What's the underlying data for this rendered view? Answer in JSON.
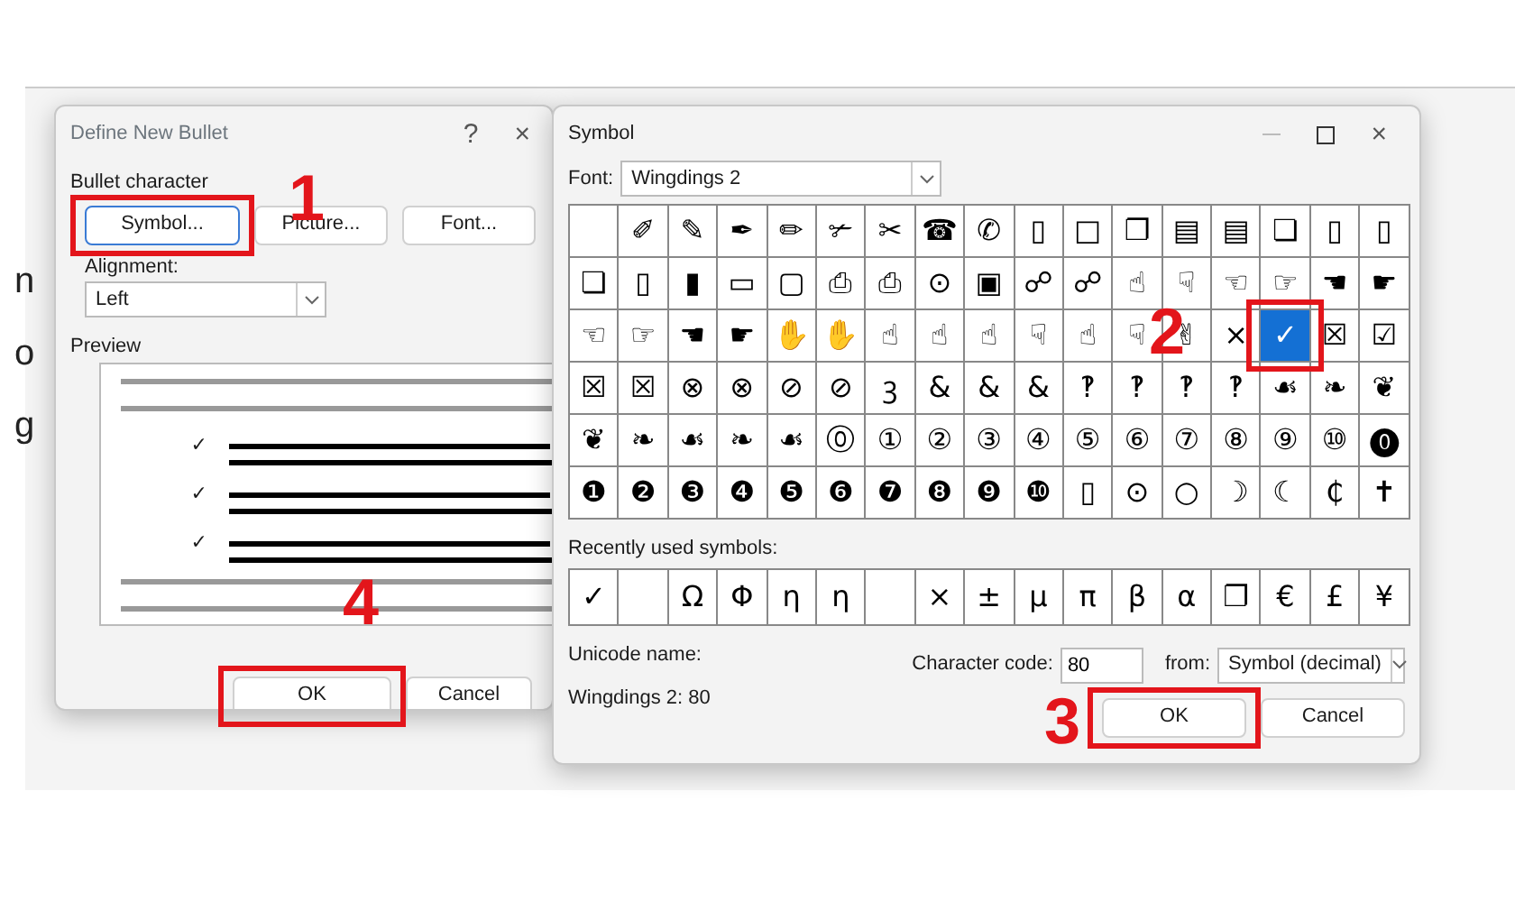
{
  "document": {
    "lines": [
      "n",
      "o",
      "g"
    ]
  },
  "bullet_dialog": {
    "title": "Define New Bullet",
    "help": "?",
    "close": "×",
    "section": "Bullet character",
    "buttons": [
      {
        "label": "Symbol...",
        "focused": true
      },
      {
        "label": "Picture...",
        "focused": false
      },
      {
        "label": "Font...",
        "focused": false
      }
    ],
    "alignment_label": "Alignment:",
    "alignment": "Left",
    "preview_label": "Preview",
    "preview_bullets": [
      "✓",
      "✓",
      "✓"
    ],
    "actions": [
      {
        "label": "OK"
      },
      {
        "label": "Cancel"
      }
    ]
  },
  "symbol_dialog": {
    "title": "Symbol",
    "close": "×",
    "font_label": "Font:",
    "font": "Wingdings 2",
    "grid": [
      [
        {
          "selected": false
        },
        {
          "char": "✐",
          "selected": false
        },
        {
          "char": "✎",
          "selected": false
        },
        {
          "char": "✒",
          "selected": false
        },
        {
          "char": "✏",
          "selected": false
        },
        {
          "char": "✃",
          "selected": false
        },
        {
          "char": "✂",
          "selected": false
        },
        {
          "char": "☎",
          "selected": false
        },
        {
          "char": "✆",
          "selected": false
        },
        {
          "char": "▯",
          "selected": false
        },
        {
          "char": "□",
          "selected": false
        },
        {
          "char": "❐",
          "selected": false
        },
        {
          "char": "▤",
          "selected": false
        },
        {
          "char": "▤",
          "selected": false
        },
        {
          "char": "❏",
          "selected": false
        },
        {
          "char": "▯",
          "selected": false
        },
        {
          "char": "▯",
          "selected": false
        }
      ],
      [
        {
          "char": "❏",
          "selected": false
        },
        {
          "char": "▯",
          "selected": false
        },
        {
          "char": "▮",
          "selected": false
        },
        {
          "char": "▭",
          "selected": false
        },
        {
          "char": "▢",
          "selected": false
        },
        {
          "char": "⎙",
          "selected": false
        },
        {
          "char": "⎙",
          "selected": false
        },
        {
          "char": "⊙",
          "selected": false
        },
        {
          "char": "▣",
          "selected": false
        },
        {
          "char": "☍",
          "selected": false
        },
        {
          "char": "☍",
          "selected": false
        },
        {
          "char": "☝",
          "selected": false
        },
        {
          "char": "☟",
          "selected": false
        },
        {
          "char": "☜",
          "selected": false
        },
        {
          "char": "☞",
          "selected": false
        },
        {
          "char": "☚",
          "selected": false
        },
        {
          "char": "☛",
          "selected": false
        }
      ],
      [
        {
          "char": "☜",
          "selected": false
        },
        {
          "char": "☞",
          "selected": false
        },
        {
          "char": "☚",
          "selected": false
        },
        {
          "char": "☛",
          "selected": false
        },
        {
          "char": "✋",
          "selected": false
        },
        {
          "char": "✋",
          "selected": false
        },
        {
          "char": "☝",
          "selected": false
        },
        {
          "char": "☝",
          "selected": false
        },
        {
          "char": "☝",
          "selected": false
        },
        {
          "char": "☟",
          "selected": false
        },
        {
          "char": "☝",
          "selected": false
        },
        {
          "char": "☟",
          "selected": false
        },
        {
          "char": "✌",
          "selected": false
        },
        {
          "char": "×",
          "selected": false
        },
        {
          "char": "✓",
          "selected": true
        },
        {
          "char": "☒",
          "selected": false
        },
        {
          "char": "☑",
          "selected": false
        }
      ],
      [
        {
          "char": "☒",
          "selected": false
        },
        {
          "char": "☒",
          "selected": false
        },
        {
          "char": "⊗",
          "selected": false
        },
        {
          "char": "⊗",
          "selected": false
        },
        {
          "char": "⊘",
          "selected": false
        },
        {
          "char": "⊘",
          "selected": false
        },
        {
          "char": "ꝫ",
          "selected": false
        },
        {
          "char": "&",
          "selected": false
        },
        {
          "char": "&",
          "selected": false
        },
        {
          "char": "&",
          "selected": false
        },
        {
          "char": "‽",
          "selected": false
        },
        {
          "char": "‽",
          "selected": false
        },
        {
          "char": "‽",
          "selected": false
        },
        {
          "char": "‽",
          "selected": false
        },
        {
          "char": "☙",
          "selected": false
        },
        {
          "char": "❧",
          "selected": false
        },
        {
          "char": "❦",
          "selected": false
        }
      ],
      [
        {
          "char": "❦",
          "selected": false
        },
        {
          "char": "❧",
          "selected": false
        },
        {
          "char": "☙",
          "selected": false
        },
        {
          "char": "❧",
          "selected": false
        },
        {
          "char": "☙",
          "selected": false
        },
        {
          "char": "⓪",
          "selected": false
        },
        {
          "char": "①",
          "selected": false
        },
        {
          "char": "②",
          "selected": false
        },
        {
          "char": "③",
          "selected": false
        },
        {
          "char": "④",
          "selected": false
        },
        {
          "char": "⑤",
          "selected": false
        },
        {
          "char": "⑥",
          "selected": false
        },
        {
          "char": "⑦",
          "selected": false
        },
        {
          "char": "⑧",
          "selected": false
        },
        {
          "char": "⑨",
          "selected": false
        },
        {
          "char": "⑩",
          "selected": false
        },
        {
          "char": "⓿",
          "selected": false
        }
      ],
      [
        {
          "char": "❶",
          "selected": false
        },
        {
          "char": "❷",
          "selected": false
        },
        {
          "char": "❸",
          "selected": false
        },
        {
          "char": "❹",
          "selected": false
        },
        {
          "char": "❺",
          "selected": false
        },
        {
          "char": "❻",
          "selected": false
        },
        {
          "char": "❼",
          "selected": false
        },
        {
          "char": "❽",
          "selected": false
        },
        {
          "char": "❾",
          "selected": false
        },
        {
          "char": "❿",
          "selected": false
        },
        {
          "char": "▯",
          "selected": false
        },
        {
          "char": "⊙",
          "selected": false
        },
        {
          "char": "○",
          "selected": false
        },
        {
          "char": "☽",
          "selected": false
        },
        {
          "char": "☾",
          "selected": false
        },
        {
          "char": "₵",
          "selected": false
        },
        {
          "char": "✝",
          "selected": false
        }
      ]
    ],
    "recent_label": "Recently used symbols:",
    "recent": [
      {
        "char": "✓",
        "selected": false
      },
      {
        "selected": false
      },
      {
        "char": "Ω",
        "selected": false
      },
      {
        "char": "Φ",
        "selected": false
      },
      {
        "char": "η",
        "selected": false
      },
      {
        "char": "η",
        "selected": false
      },
      {
        "selected": false
      },
      {
        "char": "×",
        "selected": false
      },
      {
        "char": "±",
        "selected": false
      },
      {
        "char": "μ",
        "selected": false
      },
      {
        "char": "π",
        "selected": false
      },
      {
        "char": "β",
        "selected": false
      },
      {
        "char": "α",
        "selected": false
      },
      {
        "char": "❐",
        "selected": false
      },
      {
        "char": "€",
        "selected": false
      },
      {
        "char": "£",
        "selected": false
      },
      {
        "char": "¥",
        "selected": false
      }
    ],
    "unicode_label": "Unicode name:",
    "unicode_value": "Wingdings 2: 80",
    "char_code_label": "Character code:",
    "char_code": "80",
    "from_label": "from:",
    "from": "Symbol (decimal)",
    "actions": [
      {
        "label": "OK"
      },
      {
        "label": "Cancel"
      }
    ]
  },
  "annotations": [
    {
      "label": "1"
    },
    {
      "label": "2"
    },
    {
      "label": "3"
    },
    {
      "label": "4"
    }
  ]
}
